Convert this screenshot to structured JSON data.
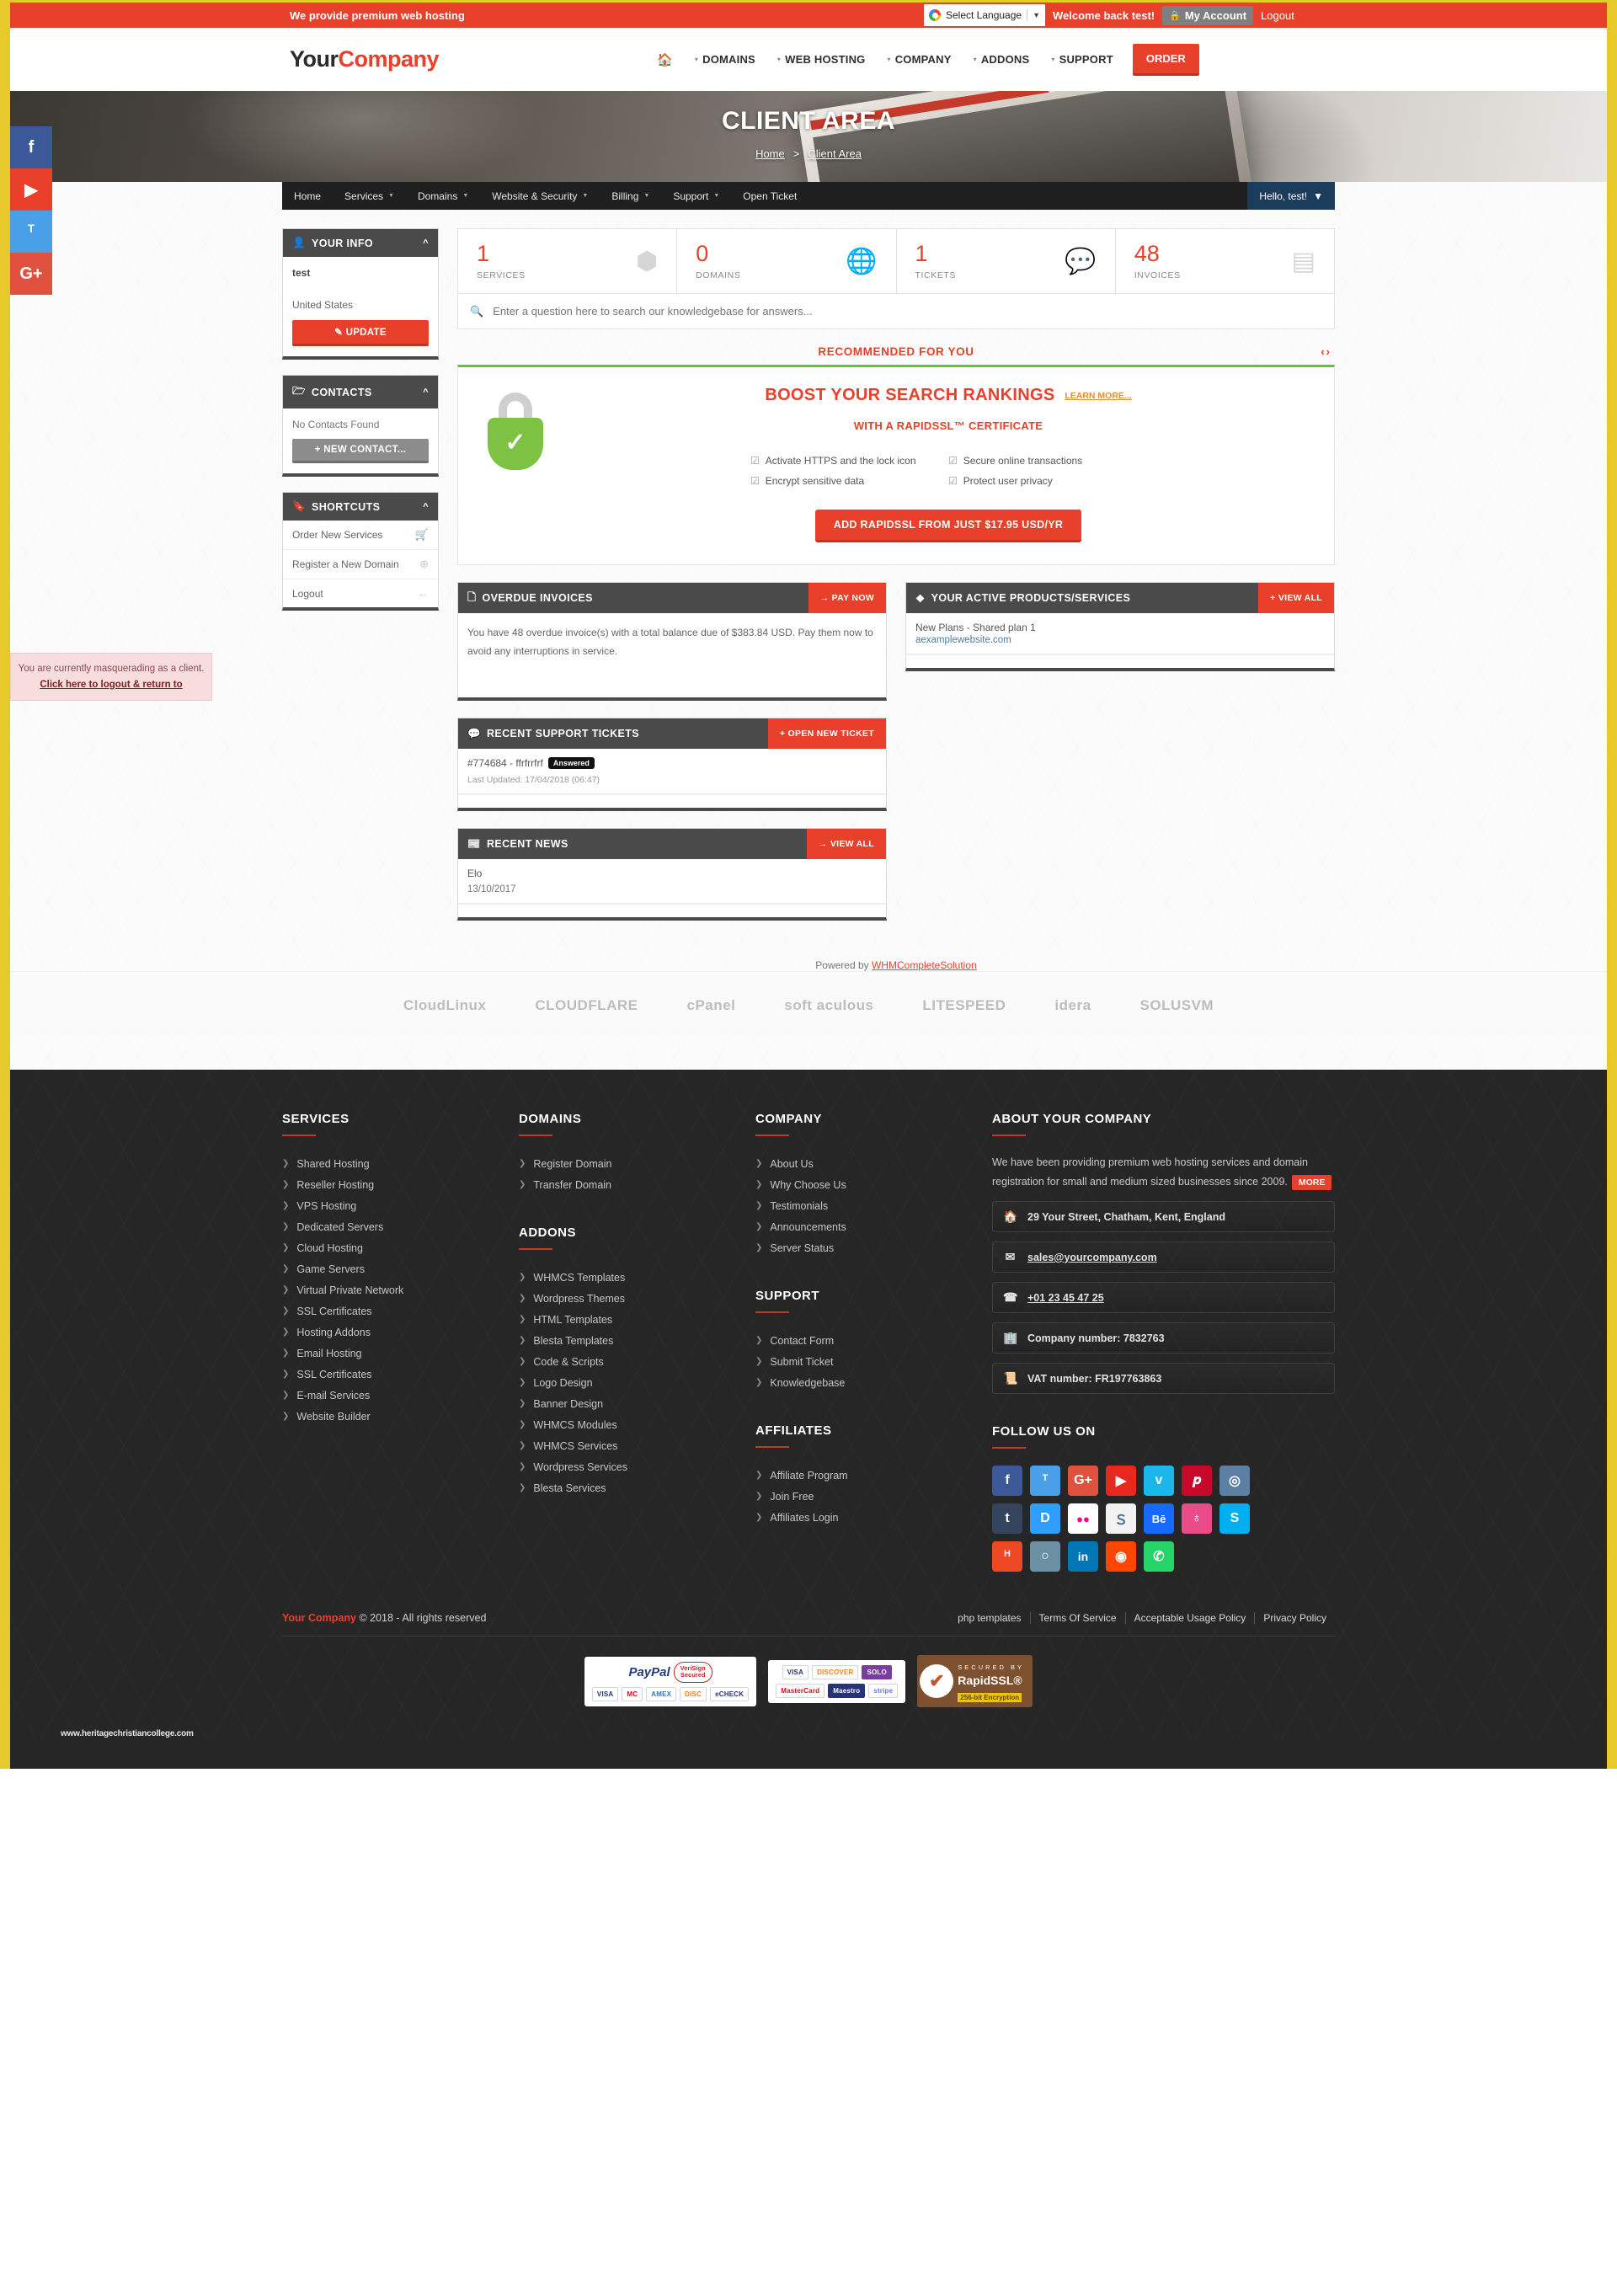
{
  "topbar": {
    "tagline_pre": "We provide ",
    "tagline_bold": "premium",
    "tagline_post": " web hosting",
    "language_label": "Select Language",
    "language_caret": "▼",
    "welcome": "Welcome back test!",
    "my_account": "My Account",
    "logout": "Logout"
  },
  "header": {
    "brand_1": "Your",
    "brand_2": "Company",
    "nav": [
      {
        "label": "",
        "icon": "home-icon",
        "caret": false
      },
      {
        "label": "DOMAINS",
        "caret": true
      },
      {
        "label": "WEB HOSTING",
        "caret": true
      },
      {
        "label": "COMPANY",
        "caret": true
      },
      {
        "label": "ADDONS",
        "caret": true
      },
      {
        "label": "SUPPORT",
        "caret": true
      }
    ],
    "order_label": "ORDER"
  },
  "hero": {
    "title": "CLIENT AREA",
    "crumb_home": "Home",
    "crumb_sep": ">",
    "crumb_current": "Client Area"
  },
  "social_rail": [
    {
      "name": "facebook",
      "glyph": "f",
      "color": "#3b5998"
    },
    {
      "name": "youtube",
      "glyph": "▶",
      "color": "#e8402a"
    },
    {
      "name": "twitter",
      "glyph": "ᵀ",
      "color": "#4aa0e8"
    },
    {
      "name": "googleplus",
      "glyph": "G+",
      "color": "#e0523f"
    }
  ],
  "masquerade": {
    "line1": "You are currently masquerading as a client.",
    "link": "Click here to logout & return to"
  },
  "clientnav": {
    "items": [
      {
        "label": "Home",
        "caret": false
      },
      {
        "label": "Services",
        "caret": true
      },
      {
        "label": "Domains",
        "caret": true
      },
      {
        "label": "Website & Security",
        "caret": true
      },
      {
        "label": "Billing",
        "caret": true
      },
      {
        "label": "Support",
        "caret": true
      },
      {
        "label": "Open Ticket",
        "caret": false
      }
    ],
    "hello": "Hello, test!"
  },
  "sidebar": {
    "your_info": {
      "title": "YOUR INFO",
      "name": "test",
      "country": "United States",
      "update_label": "UPDATE"
    },
    "contacts": {
      "title": "CONTACTS",
      "empty": "No Contacts Found",
      "new_contact_label": "+ NEW CONTACT..."
    },
    "shortcuts": {
      "title": "SHORTCUTS",
      "items": [
        {
          "label": "Order New Services",
          "icon": "cart-icon",
          "glyph": "🛒"
        },
        {
          "label": "Register a New Domain",
          "icon": "globe-icon",
          "glyph": "⊕"
        },
        {
          "label": "Logout",
          "icon": "arrow-left-icon",
          "glyph": "←"
        }
      ]
    }
  },
  "stats": [
    {
      "value": "1",
      "label": "SERVICES",
      "icon": "box-icon",
      "glyph": "⬢"
    },
    {
      "value": "0",
      "label": "DOMAINS",
      "icon": "globe-icon",
      "glyph": "🌐"
    },
    {
      "value": "1",
      "label": "TICKETS",
      "icon": "chat-icon",
      "glyph": "💬"
    },
    {
      "value": "48",
      "label": "INVOICES",
      "icon": "card-icon",
      "glyph": "▤"
    }
  ],
  "search": {
    "placeholder": "Enter a question here to search our knowledgebase for answers...",
    "value": ""
  },
  "recommended": {
    "heading": "RECOMMENDED FOR YOU",
    "arrow_prev": "‹",
    "arrow_next": "›",
    "promo_headline": "BOOST YOUR SEARCH RANKINGS",
    "promo_learn_more": "LEARN MORE...",
    "promo_subhead": "WITH A RAPIDSSL™ CERTIFICATE",
    "features": [
      "Activate HTTPS and the lock icon",
      "Secure online transactions",
      "Encrypt sensitive data",
      "Protect user privacy"
    ],
    "cta": "ADD RAPIDSSL FROM JUST $17.95 USD/YR"
  },
  "cards": {
    "overdue": {
      "title": "OVERDUE INVOICES",
      "button": "→ PAY NOW",
      "body": "You have 48 overdue invoice(s) with a total balance due of $383.84 USD. Pay them now to avoid any interruptions in service."
    },
    "active_products": {
      "title": "YOUR ACTIVE PRODUCTS/SERVICES",
      "button": "+ VIEW ALL",
      "plan": "New Plans - Shared plan 1",
      "domain": "aexamplewebsite.com"
    },
    "tickets": {
      "title": "RECENT SUPPORT TICKETS",
      "button": "+ OPEN NEW TICKET",
      "ticket_id": "#774684 - ffrfrrfrf",
      "status": "Answered",
      "updated": "Last Updated: 17/04/2018 (06:47)"
    },
    "news": {
      "title": "RECENT NEWS",
      "button": "→ VIEW ALL",
      "item_title": "Elo",
      "item_date": "13/10/2017"
    }
  },
  "powered": {
    "prefix": "Powered by ",
    "link": "WHMCompleteSolution"
  },
  "partners": [
    "CloudLinux",
    "CLOUDFLARE",
    "cPanel",
    "soft aculous",
    "LITESPEED",
    "idera",
    "SOLUSVM"
  ],
  "footer": {
    "services": {
      "title": "SERVICES",
      "items": [
        "Shared Hosting",
        "Reseller Hosting",
        "VPS Hosting",
        "Dedicated Servers",
        "Cloud Hosting",
        "Game Servers",
        "Virtual Private Network",
        "SSL Certificates",
        "Hosting Addons",
        "Email Hosting",
        "SSL Certificates",
        "E-mail Services",
        "Website Builder"
      ]
    },
    "domains": {
      "title": "DOMAINS",
      "items": [
        "Register Domain",
        "Transfer Domain"
      ]
    },
    "addons": {
      "title": "ADDONS",
      "items": [
        "WHMCS Templates",
        "Wordpress Themes",
        "HTML Templates",
        "Blesta Templates",
        "Code & Scripts",
        "Logo Design",
        "Banner Design",
        "WHMCS Modules",
        "WHMCS Services",
        "Wordpress Services",
        "Blesta Services"
      ]
    },
    "company": {
      "title": "COMPANY",
      "items": [
        "About Us",
        "Why Choose Us",
        "Testimonials",
        "Announcements",
        "Server Status"
      ]
    },
    "support": {
      "title": "SUPPORT",
      "items": [
        "Contact Form",
        "Submit Ticket",
        "Knowledgebase"
      ]
    },
    "affiliates": {
      "title": "AFFILIATES",
      "items": [
        "Affiliate Program",
        "Join Free",
        "Affiliates Login"
      ]
    },
    "about": {
      "title": "ABOUT YOUR COMPANY",
      "text": "We have been providing premium web hosting services and domain registration for small and medium sized businesses since 2009.",
      "more": "MORE",
      "address": "29 Your Street, Chatham, Kent, England",
      "email": "sales@yourcompany.com",
      "phone": "+01 23 45 47 25",
      "company_number": "Company number: 7832763",
      "vat_number": "VAT number: FR197763863"
    },
    "follow": {
      "title": "FOLLOW US ON",
      "icons": [
        {
          "name": "facebook",
          "glyph": "f",
          "color": "#3b5998"
        },
        {
          "name": "twitter",
          "glyph": "ᵀ",
          "color": "#4aa0e8"
        },
        {
          "name": "googleplus",
          "glyph": "G+",
          "color": "#e0523f"
        },
        {
          "name": "youtube",
          "glyph": "▶",
          "color": "#e8281f"
        },
        {
          "name": "vimeo",
          "glyph": "v",
          "color": "#1ab7ea"
        },
        {
          "name": "pinterest",
          "glyph": "𝒑",
          "color": "#c8082a"
        },
        {
          "name": "instagram",
          "glyph": "◎",
          "color": "#5c7fa3"
        },
        {
          "name": "tumblr",
          "glyph": "t",
          "color": "#33445c"
        },
        {
          "name": "disqus",
          "glyph": "D",
          "color": "#2e9fff"
        },
        {
          "name": "flickr",
          "glyph": "●●",
          "color": "#ffffff"
        },
        {
          "name": "steem",
          "glyph": "Ｓ",
          "color": "#f2f2f2"
        },
        {
          "name": "behance",
          "glyph": "Bē",
          "color": "#1769ff"
        },
        {
          "name": "dribbble",
          "glyph": "♁",
          "color": "#ea4c89"
        },
        {
          "name": "skype",
          "glyph": "S",
          "color": "#00aff0"
        },
        {
          "name": "stumbleupon",
          "glyph": "ᴴ",
          "color": "#eb4823"
        },
        {
          "name": "github",
          "glyph": "○",
          "color": "#6b8fa3"
        },
        {
          "name": "linkedin",
          "glyph": "in",
          "color": "#0077b5"
        },
        {
          "name": "reddit",
          "glyph": "◉",
          "color": "#ff4500"
        },
        {
          "name": "whatsapp",
          "glyph": "✆",
          "color": "#25d366"
        }
      ]
    },
    "bottom": {
      "brand": "Your Company",
      "copyright": " © 2018 - All rights reserved",
      "links": [
        "php templates",
        "Terms Of Service",
        "Acceptable Usage Policy",
        "Privacy Policy"
      ]
    },
    "payments": {
      "paypal": "PayPal",
      "verisign_1": "VeriSign",
      "verisign_2": "Secured",
      "paypal_cards": [
        "VISA",
        "MC",
        "AMEX",
        "DISC",
        "eCHECK"
      ],
      "cards_top": [
        "VISA",
        "DISCOVER",
        "SOLO"
      ],
      "cards_bottom": [
        "MasterCard",
        "Maestro",
        "stripe"
      ],
      "rapidssl_top": "SECURED BY",
      "rapidssl_mid": "RapidSSL®",
      "rapidssl_bot": "256-bit Encryption"
    },
    "watermark": "www.heritagechristiancollege.com"
  }
}
